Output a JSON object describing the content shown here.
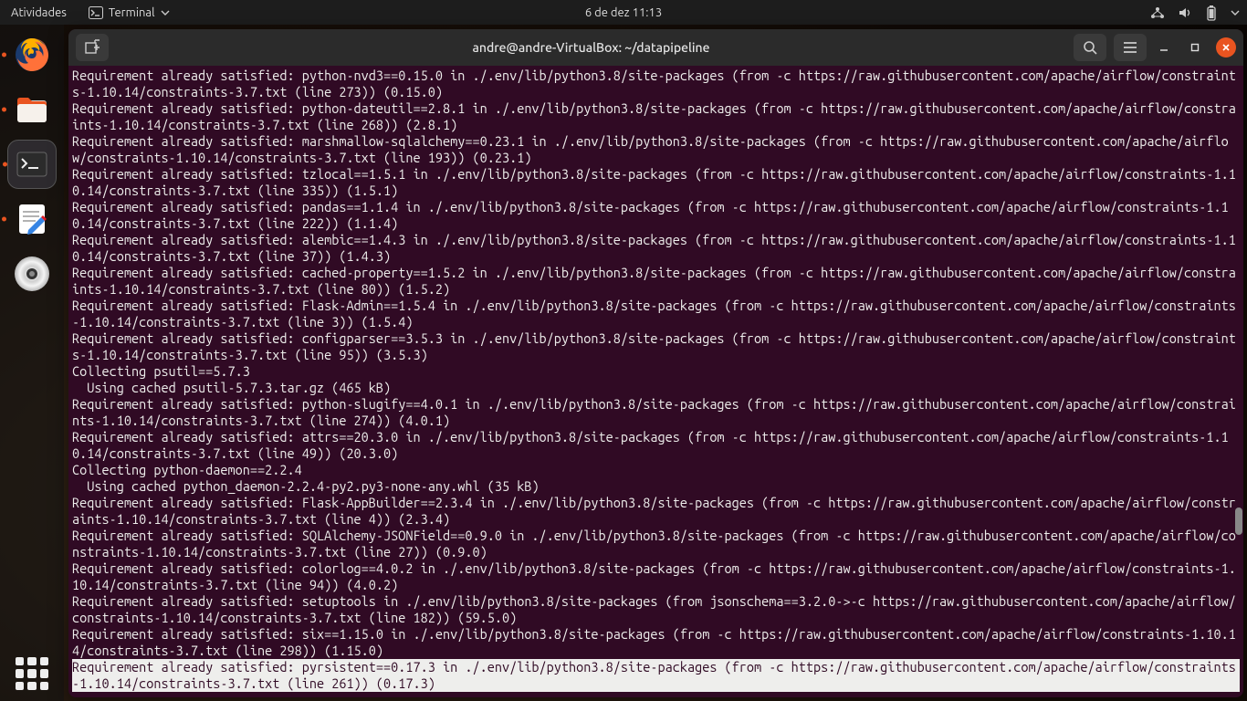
{
  "panel": {
    "activities": "Atividades",
    "app_name": "Terminal",
    "clock": "6 de dez  11:13"
  },
  "window": {
    "title": "andre@andre-VirtualBox: ~/datapipeline"
  },
  "terminal": {
    "lines": [
      "Requirement already satisfied: python-nvd3==0.15.0 in ./.env/lib/python3.8/site-packages (from -c https://raw.githubusercontent.com/apache/airflow/constraints-1.10.14/constraints-3.7.txt (line 273)) (0.15.0)",
      "Requirement already satisfied: python-dateutil==2.8.1 in ./.env/lib/python3.8/site-packages (from -c https://raw.githubusercontent.com/apache/airflow/constraints-1.10.14/constraints-3.7.txt (line 268)) (2.8.1)",
      "Requirement already satisfied: marshmallow-sqlalchemy==0.23.1 in ./.env/lib/python3.8/site-packages (from -c https://raw.githubusercontent.com/apache/airflow/constraints-1.10.14/constraints-3.7.txt (line 193)) (0.23.1)",
      "Requirement already satisfied: tzlocal==1.5.1 in ./.env/lib/python3.8/site-packages (from -c https://raw.githubusercontent.com/apache/airflow/constraints-1.10.14/constraints-3.7.txt (line 335)) (1.5.1)",
      "Requirement already satisfied: pandas==1.1.4 in ./.env/lib/python3.8/site-packages (from -c https://raw.githubusercontent.com/apache/airflow/constraints-1.10.14/constraints-3.7.txt (line 222)) (1.1.4)",
      "Requirement already satisfied: alembic==1.4.3 in ./.env/lib/python3.8/site-packages (from -c https://raw.githubusercontent.com/apache/airflow/constraints-1.10.14/constraints-3.7.txt (line 37)) (1.4.3)",
      "Requirement already satisfied: cached-property==1.5.2 in ./.env/lib/python3.8/site-packages (from -c https://raw.githubusercontent.com/apache/airflow/constraints-1.10.14/constraints-3.7.txt (line 80)) (1.5.2)",
      "Requirement already satisfied: Flask-Admin==1.5.4 in ./.env/lib/python3.8/site-packages (from -c https://raw.githubusercontent.com/apache/airflow/constraints-1.10.14/constraints-3.7.txt (line 3)) (1.5.4)",
      "Requirement already satisfied: configparser==3.5.3 in ./.env/lib/python3.8/site-packages (from -c https://raw.githubusercontent.com/apache/airflow/constraints-1.10.14/constraints-3.7.txt (line 95)) (3.5.3)",
      "Collecting psutil==5.7.3",
      "  Using cached psutil-5.7.3.tar.gz (465 kB)",
      "Requirement already satisfied: python-slugify==4.0.1 in ./.env/lib/python3.8/site-packages (from -c https://raw.githubusercontent.com/apache/airflow/constraints-1.10.14/constraints-3.7.txt (line 274)) (4.0.1)",
      "Requirement already satisfied: attrs==20.3.0 in ./.env/lib/python3.8/site-packages (from -c https://raw.githubusercontent.com/apache/airflow/constraints-1.10.14/constraints-3.7.txt (line 49)) (20.3.0)",
      "Collecting python-daemon==2.2.4",
      "  Using cached python_daemon-2.2.4-py2.py3-none-any.whl (35 kB)",
      "Requirement already satisfied: Flask-AppBuilder==2.3.4 in ./.env/lib/python3.8/site-packages (from -c https://raw.githubusercontent.com/apache/airflow/constraints-1.10.14/constraints-3.7.txt (line 4)) (2.3.4)",
      "Requirement already satisfied: SQLAlchemy-JSONField==0.9.0 in ./.env/lib/python3.8/site-packages (from -c https://raw.githubusercontent.com/apache/airflow/constraints-1.10.14/constraints-3.7.txt (line 27)) (0.9.0)",
      "Requirement already satisfied: colorlog==4.0.2 in ./.env/lib/python3.8/site-packages (from -c https://raw.githubusercontent.com/apache/airflow/constraints-1.10.14/constraints-3.7.txt (line 94)) (4.0.2)",
      "Requirement already satisfied: setuptools in ./.env/lib/python3.8/site-packages (from jsonschema==3.2.0->-c https://raw.githubusercontent.com/apache/airflow/constraints-1.10.14/constraints-3.7.txt (line 182)) (59.5.0)",
      "Requirement already satisfied: six==1.15.0 in ./.env/lib/python3.8/site-packages (from -c https://raw.githubusercontent.com/apache/airflow/constraints-1.10.14/constraints-3.7.txt (line 298)) (1.15.0)",
      "Requirement already satisfied: pyrsistent==0.17.3 in ./.env/lib/python3.8/site-packages (from -c https://raw.githubusercontent.com/apache/airflow/constraints-1.10.14/constraints-3.7.txt (line 261)) (0.17.3)"
    ],
    "selected_index": 20
  }
}
